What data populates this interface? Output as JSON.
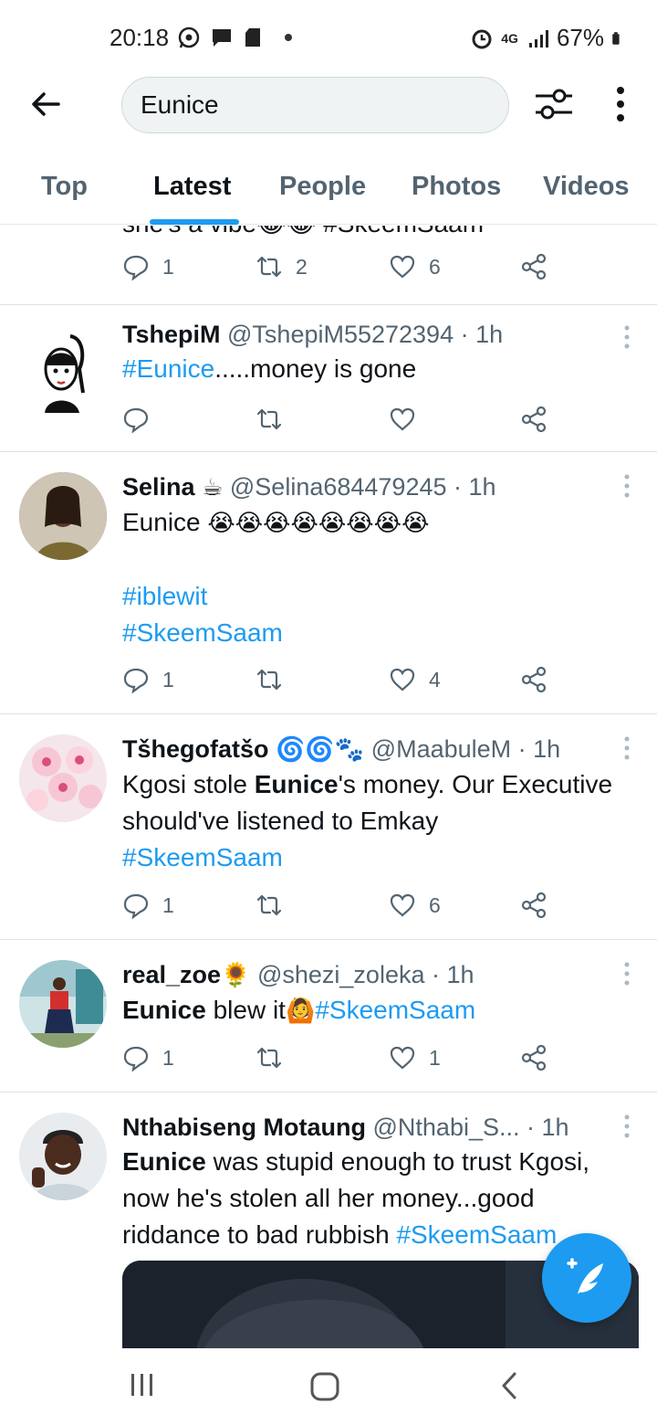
{
  "status_bar": {
    "time": "20:18",
    "network": "4G",
    "battery": "67%"
  },
  "search": {
    "query": "Eunice"
  },
  "tabs": [
    {
      "label": "Top"
    },
    {
      "label": "Latest"
    },
    {
      "label": "People"
    },
    {
      "label": "Photos"
    },
    {
      "label": "Videos"
    }
  ],
  "partial_tweet": {
    "text": "she's a vibe😂😂 #SkeemSaam",
    "replies": "1",
    "retweets": "2",
    "likes": "6"
  },
  "tweets": [
    {
      "name": "TshepiM",
      "handle": "@TshepiM55272394",
      "time": "· 1h",
      "hashtag": "#Eunice",
      "text": ".....money is gone",
      "replies": "",
      "retweets": "",
      "likes": ""
    },
    {
      "name": "Selina",
      "name_emoji": "☕",
      "handle": "@Selina684479245",
      "time": "· 1h",
      "text": "Eunice ",
      "text_emoji": "😭😭😭😭😭😭😭😭",
      "hashtag1": "#iblewit",
      "hashtag2": "#SkeemSaam",
      "replies": "1",
      "retweets": "",
      "likes": "4"
    },
    {
      "name": "Tšhegofatšo",
      "name_emoji": "🌀🌀🐾",
      "handle": "@MaabuleM",
      "time": "· 1h",
      "text_pre": "Kgosi stole ",
      "text_bold": "Eunice",
      "text_post": "'s money. Our Executive should've listened to Emkay",
      "hashtag": "#SkeemSaam",
      "replies": "1",
      "retweets": "",
      "likes": "6"
    },
    {
      "name": "real_zoe",
      "name_emoji": "🌻",
      "handle": "@shezi_zoleka",
      "time": "· 1h",
      "text_bold": "Eunice",
      "text_post": " blew it",
      "text_emoji": "🙆",
      "hashtag": "#SkeemSaam",
      "replies": "1",
      "retweets": "",
      "likes": "1"
    },
    {
      "name": "Nthabiseng Motaung",
      "handle": "@Nthabi_S...",
      "time": "· 1h",
      "text_bold": "Eunice",
      "text_post": " was stupid enough to trust Kgosi, now he's stolen all her money...good riddance to bad rubbish ",
      "hashtag": "#SkeemSaam"
    }
  ],
  "colors": {
    "accent": "#1d9bf0",
    "text": "#0f1419",
    "muted": "#536471"
  }
}
